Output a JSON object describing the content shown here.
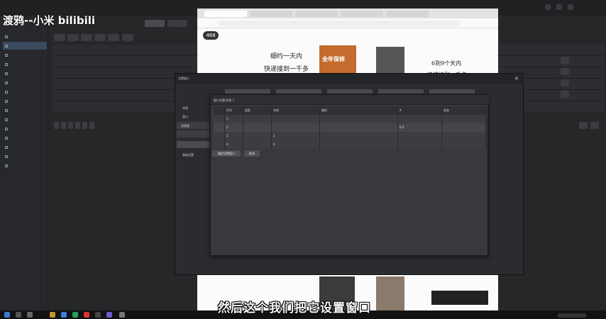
{
  "watermark": {
    "text": "渡鸦--小米 bilibili"
  },
  "subtitle": {
    "text": "然后这个我们把它设置窗口"
  },
  "browser": {
    "page": {
      "price_badge": "468",
      "banner_left_line1": "细约一天内",
      "banner_left_line2": "快递接到一千多",
      "banner_right_line1": "6到9个天内",
      "banner_right_line2": "快递接到一千多",
      "red_card": "全年保修"
    }
  },
  "dialog": {
    "title": "设置窗口",
    "sidebar_items": [
      "常规",
      "窗口",
      "快捷键",
      "高级设置"
    ],
    "sub_title": "窗口设置/列表 1",
    "table": {
      "headers": [
        "序号",
        "类型",
        "名称",
        "路径",
        "X",
        "状态"
      ],
      "rows": [
        [
          "1",
          "",
          "",
          "",
          "",
          ""
        ],
        [
          "2",
          "",
          "",
          "",
          "0.0",
          ""
        ],
        [
          "3",
          "",
          "2",
          "",
          "",
          ""
        ],
        [
          "4",
          "",
          "0",
          "",
          "",
          ""
        ]
      ]
    },
    "buttons": {
      "confirm": "确定设置窗口",
      "cancel": "取消"
    }
  }
}
